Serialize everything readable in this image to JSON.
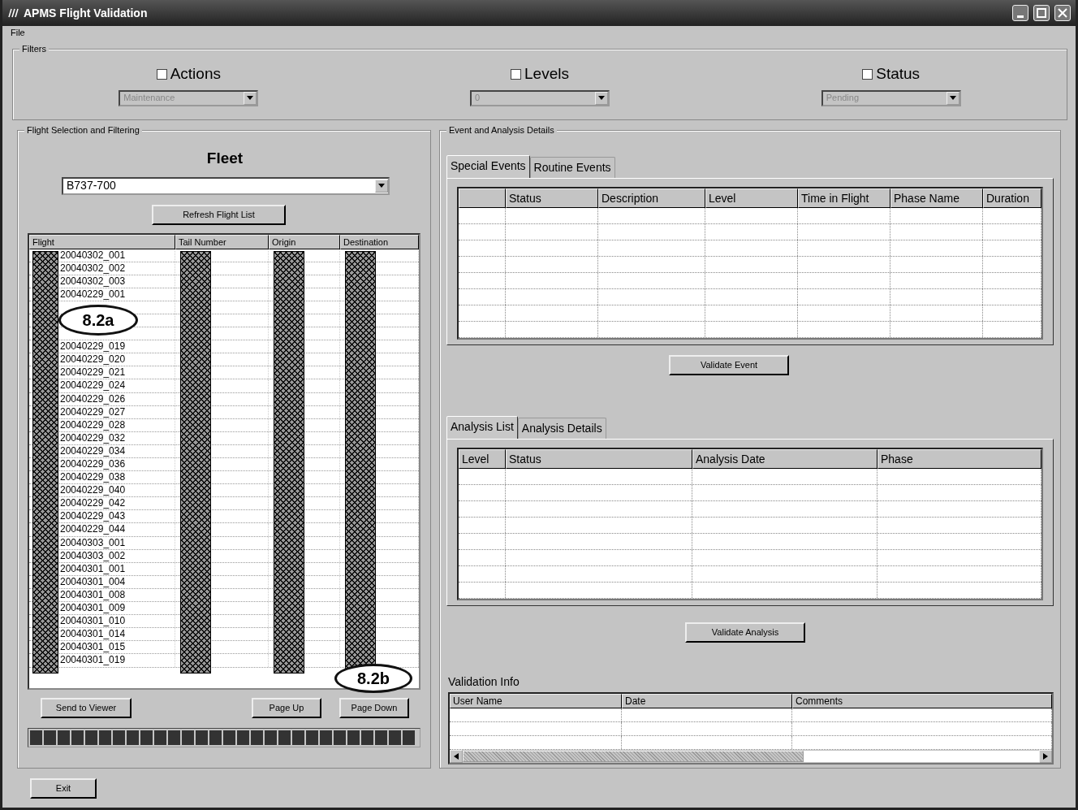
{
  "window": {
    "title": "APMS Flight Validation"
  },
  "menu": [
    "File"
  ],
  "filters": {
    "legend": "Filters",
    "items": [
      {
        "label": "Actions",
        "checked": false,
        "value": "Maintenance",
        "disabled": true
      },
      {
        "label": "Levels",
        "checked": false,
        "value": "0",
        "disabled": true
      },
      {
        "label": "Status",
        "checked": false,
        "value": "Pending",
        "disabled": true
      }
    ]
  },
  "flight_selection": {
    "legend": "Flight Selection and Filtering",
    "fleet_label": "Fleet",
    "fleet_value": "B737-700",
    "refresh_button": "Refresh Flight List",
    "columns": [
      "Flight",
      "Tail Number",
      "Origin",
      "Destination"
    ],
    "rows": [
      {
        "flight": "20040302_001"
      },
      {
        "flight": "20040302_002"
      },
      {
        "flight": "20040302_003"
      },
      {
        "flight": "20040229_001"
      },
      {},
      {},
      {},
      {
        "flight": "20040229_019"
      },
      {
        "flight": "20040229_020"
      },
      {
        "flight": "20040229_021"
      },
      {
        "flight": "20040229_024"
      },
      {
        "flight": "20040229_026"
      },
      {
        "flight": "20040229_027"
      },
      {
        "flight": "20040229_028"
      },
      {
        "flight": "20040229_032"
      },
      {
        "flight": "20040229_034"
      },
      {
        "flight": "20040229_036"
      },
      {
        "flight": "20040229_038"
      },
      {
        "flight": "20040229_040"
      },
      {
        "flight": "20040229_042"
      },
      {
        "flight": "20040229_043"
      },
      {
        "flight": "20040229_044"
      },
      {
        "flight": "20040303_001"
      },
      {
        "flight": "20040303_002"
      },
      {
        "flight": "20040301_001"
      },
      {
        "flight": "20040301_004"
      },
      {
        "flight": "20040301_008"
      },
      {
        "flight": "20040301_009"
      },
      {
        "flight": "20040301_010"
      },
      {
        "flight": "20040301_014"
      },
      {
        "flight": "20040301_015"
      },
      {
        "flight": "20040301_019"
      }
    ],
    "buttons": [
      "Send to Viewer",
      "Page Up",
      "Page Down"
    ],
    "progress": {
      "level": 1
    }
  },
  "details": {
    "legend": "Event and Analysis Details",
    "event_tabs": [
      {
        "label": "Special Events",
        "selected": true
      },
      {
        "label": "Routine Events",
        "selected": false
      }
    ],
    "event_columns": [
      {},
      {
        "label": "Status"
      },
      {
        "label": "Description"
      },
      {
        "label": "Level"
      },
      {
        "label": "Time in Flight"
      },
      {
        "label": "Phase Name"
      },
      {
        "label": "Duration"
      }
    ],
    "validate_event_button": "Validate Event",
    "analysis_tabs": [
      {
        "label": "Analysis List",
        "selected": true
      },
      {
        "label": "Analysis Details",
        "selected": false
      }
    ],
    "analysis_columns": [
      "Level",
      "Status",
      "Analysis Date",
      "Phase"
    ],
    "validate_analysis_button": "Validate Analysis",
    "validation_info": {
      "title": "Validation Info",
      "columns": [
        "User Name",
        "Date",
        "Comments"
      ]
    }
  },
  "exit_button": "Exit",
  "callouts": [
    {
      "label": "8.2a"
    },
    {
      "label": "8.2b"
    }
  ]
}
